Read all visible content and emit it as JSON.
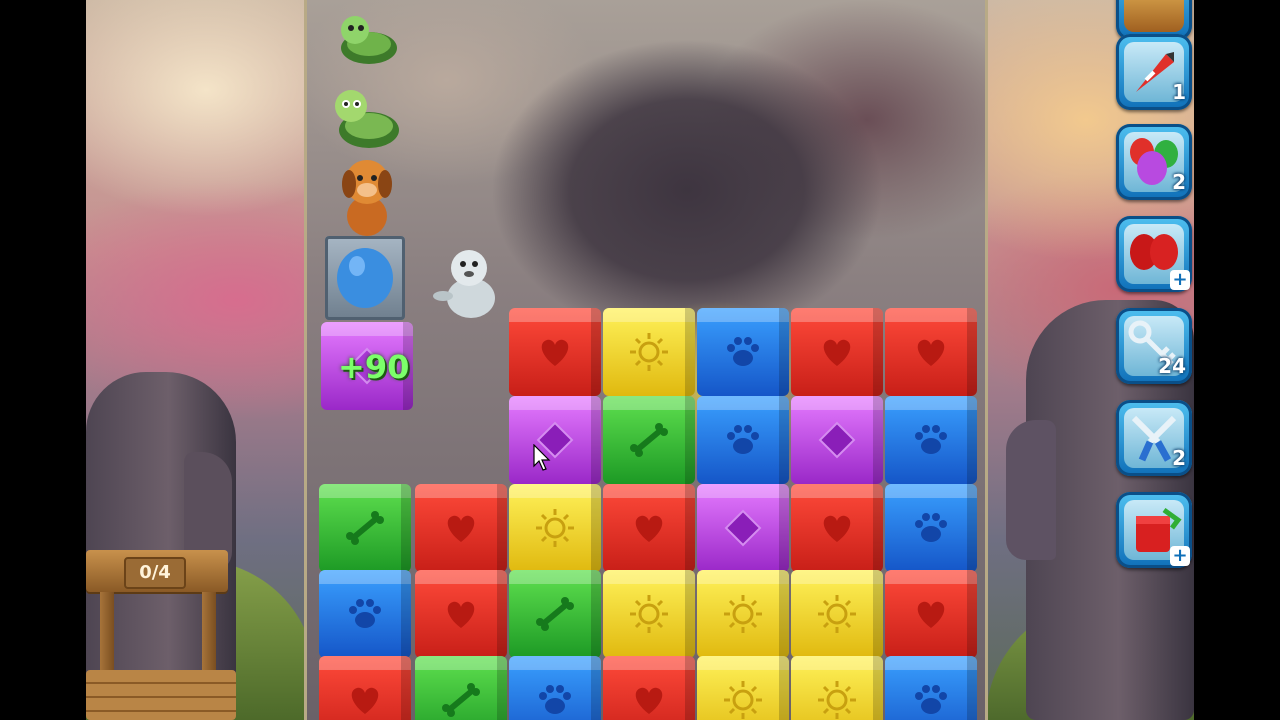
{
  "well": {
    "counter": "0/4"
  },
  "score_popup": "+90",
  "tools": [
    {
      "name": "rocket",
      "count": "1",
      "badge": ""
    },
    {
      "name": "balloons",
      "count": "2",
      "badge": ""
    },
    {
      "name": "boxing-gloves",
      "count": "",
      "badge": "+"
    },
    {
      "name": "key",
      "count": "24",
      "badge": ""
    },
    {
      "name": "pliers",
      "count": "2",
      "badge": ""
    },
    {
      "name": "paint-bucket",
      "count": "",
      "badge": "+"
    }
  ],
  "grid": {
    "rows": [
      [
        "red",
        "yellow",
        "blue",
        "red",
        "red"
      ],
      [
        "purple",
        "green",
        "blue",
        "purple",
        "blue"
      ],
      [
        "green",
        "red",
        "yellow",
        "red",
        "purple",
        "red",
        "blue"
      ],
      [
        "blue",
        "red",
        "green",
        "yellow",
        "yellow",
        "yellow",
        "red"
      ],
      [
        "red",
        "green",
        "blue",
        "red",
        "yellow",
        "yellow",
        "blue"
      ]
    ]
  },
  "colors": {
    "red": "#d82a20",
    "yellow": "#f0d020",
    "blue": "#2072e0",
    "green": "#2fae35",
    "purple": "#b540e0",
    "panel": "#1a86d0"
  }
}
